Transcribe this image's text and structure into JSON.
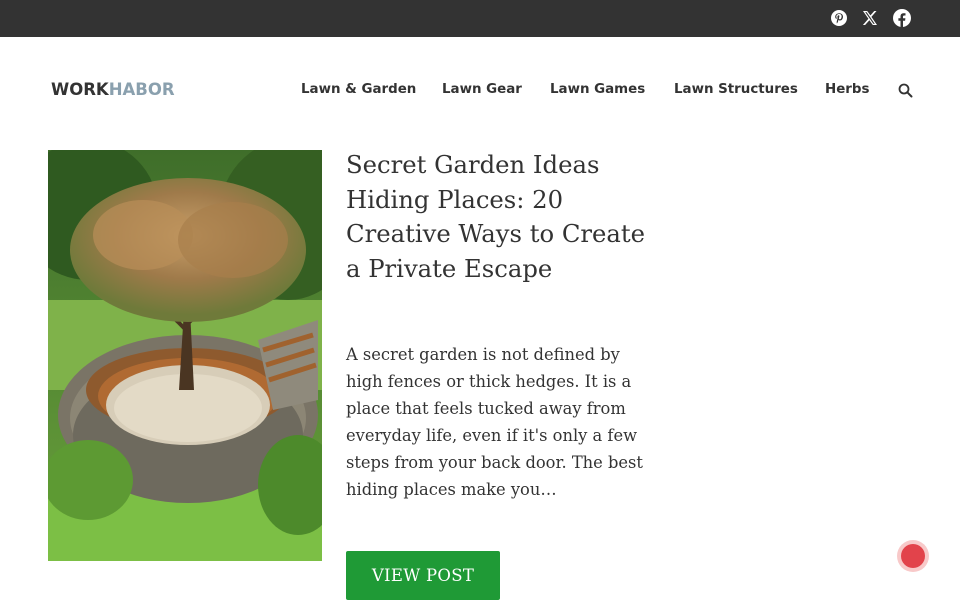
{
  "topbar": {
    "social": [
      {
        "name": "pinterest-icon"
      },
      {
        "name": "x-icon"
      },
      {
        "name": "facebook-icon"
      }
    ]
  },
  "header": {
    "logo_part1": "WORK",
    "logo_part2": "HABOR",
    "nav": [
      "Lawn & Garden",
      "Lawn Gear",
      "Lawn Games",
      "Lawn Structures",
      "Herbs"
    ],
    "search_icon": "search-icon"
  },
  "post": {
    "title": "Secret Garden Ideas Hiding Places: 20 Creative Ways to Create a Private Escape",
    "excerpt": "A secret garden is not defined by high fences or thick hedges. It is a place that feels tucked away from everyday life, even if it's only a few steps from your back door. The best hiding places make you…",
    "button": "VIEW POST",
    "image": "sunken stone garden seating area with curved wooden bench around a maple tree"
  },
  "notification_bell": "bell-icon",
  "colors": {
    "topbar": "#333333",
    "logo_accent": "#8aa0ae",
    "button": "#1f9a36",
    "notification": "#e2434b"
  }
}
